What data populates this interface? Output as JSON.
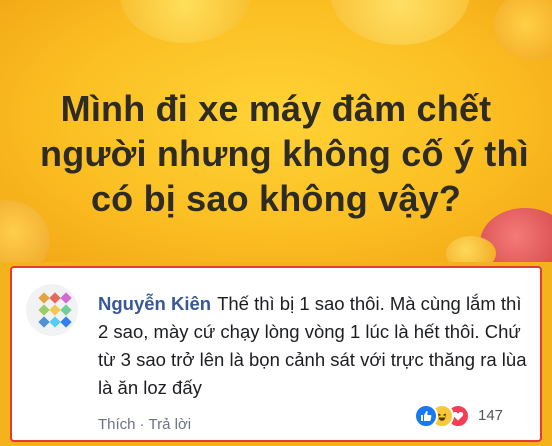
{
  "question": {
    "lines": [
      "Mình đi xe máy đâm chết",
      "người nhưng không cố ý thì",
      "có bị sao không vậy?"
    ]
  },
  "comment": {
    "author": "Nguyễn Kiên",
    "text": "Thế thì bị 1 sao thôi. Mà cùng lắm thì 2 sao, mày cứ chạy lòng vòng 1 lúc là hết thôi. Chứ từ 3 sao trở lên là bọn cảnh sát với trực thăng ra lùa là ăn loz đấy",
    "actions": {
      "like_label": "Thích",
      "separator": "·",
      "reply_label": "Trả lời"
    },
    "reactions": {
      "icons": [
        "like-icon",
        "haha-icon",
        "love-icon"
      ],
      "count": "147"
    }
  },
  "colors": {
    "background_yellow": "#fbbf22",
    "comment_border": "#e53a32",
    "author_blue": "#385898",
    "like_blue": "#1877f2",
    "love_red": "#f33e58",
    "haha_yellow": "#f7c83a"
  }
}
